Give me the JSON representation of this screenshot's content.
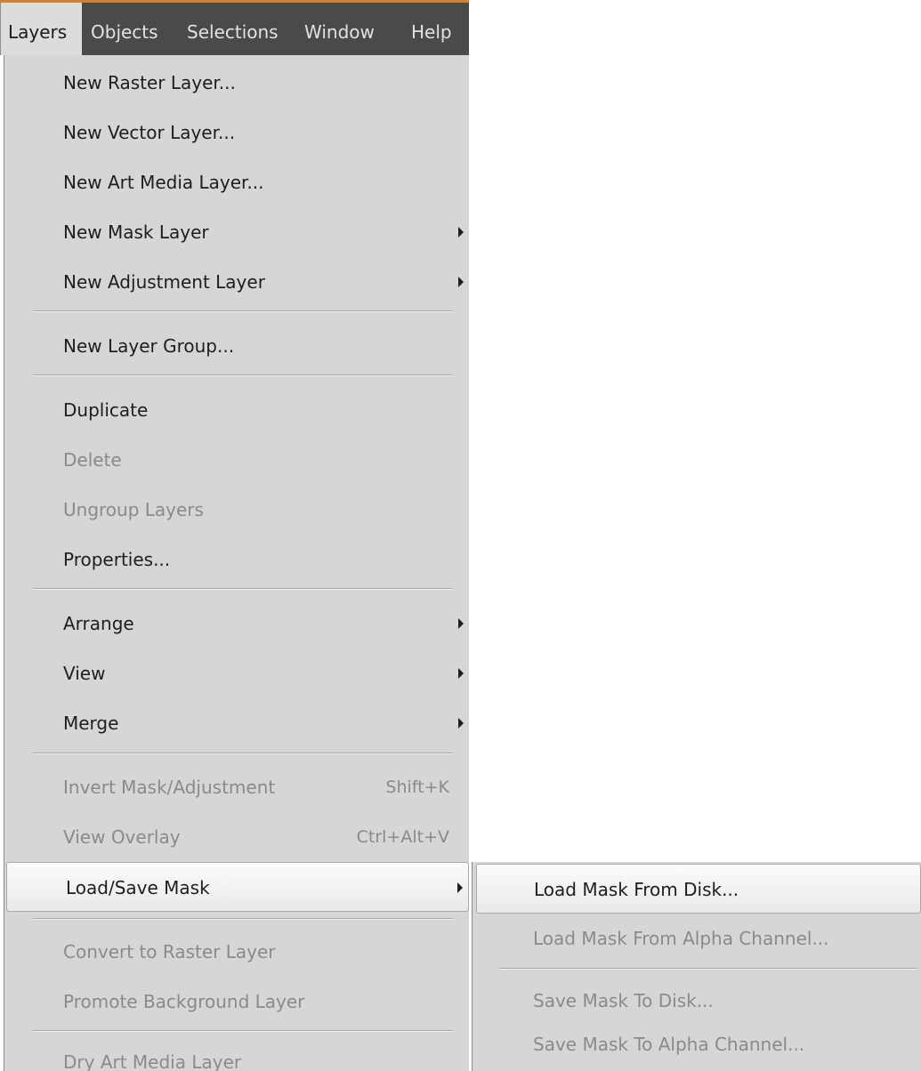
{
  "menubar": {
    "items": [
      {
        "label": "Layers",
        "active": true
      },
      {
        "label": "Objects"
      },
      {
        "label": "Selections"
      },
      {
        "label": "Window"
      },
      {
        "label": "Help"
      }
    ]
  },
  "menu": {
    "items": {
      "new_raster_layer": {
        "label": "New Raster Layer..."
      },
      "new_vector_layer": {
        "label": "New Vector Layer..."
      },
      "new_art_media_layer": {
        "label": "New Art Media Layer..."
      },
      "new_mask_layer": {
        "label": "New Mask Layer"
      },
      "new_adjustment_layer": {
        "label": "New Adjustment Layer"
      },
      "new_layer_group": {
        "label": "New Layer Group..."
      },
      "duplicate": {
        "label": "Duplicate"
      },
      "delete": {
        "label": "Delete"
      },
      "ungroup_layers": {
        "label": "Ungroup Layers"
      },
      "properties": {
        "label": "Properties..."
      },
      "arrange": {
        "label": "Arrange"
      },
      "view": {
        "label": "View"
      },
      "merge": {
        "label": "Merge"
      },
      "invert_mask_adjustment": {
        "label": "Invert Mask/Adjustment",
        "shortcut": "Shift+K"
      },
      "view_overlay": {
        "label": "View Overlay",
        "shortcut": "Ctrl+Alt+V"
      },
      "load_save_mask": {
        "label": "Load/Save Mask"
      },
      "convert_to_raster_layer": {
        "label": "Convert to Raster Layer"
      },
      "promote_background_layer": {
        "label": "Promote Background Layer"
      },
      "dry_art_media_layer": {
        "label": "Dry Art Media Layer"
      }
    }
  },
  "submenu": {
    "items": {
      "load_mask_from_disk": {
        "label": "Load Mask From Disk..."
      },
      "load_mask_from_alpha_channel": {
        "label": "Load Mask From Alpha Channel..."
      },
      "save_mask_to_disk": {
        "label": "Save Mask To Disk..."
      },
      "save_mask_to_alpha_channel": {
        "label": "Save Mask To Alpha Channel..."
      }
    }
  }
}
